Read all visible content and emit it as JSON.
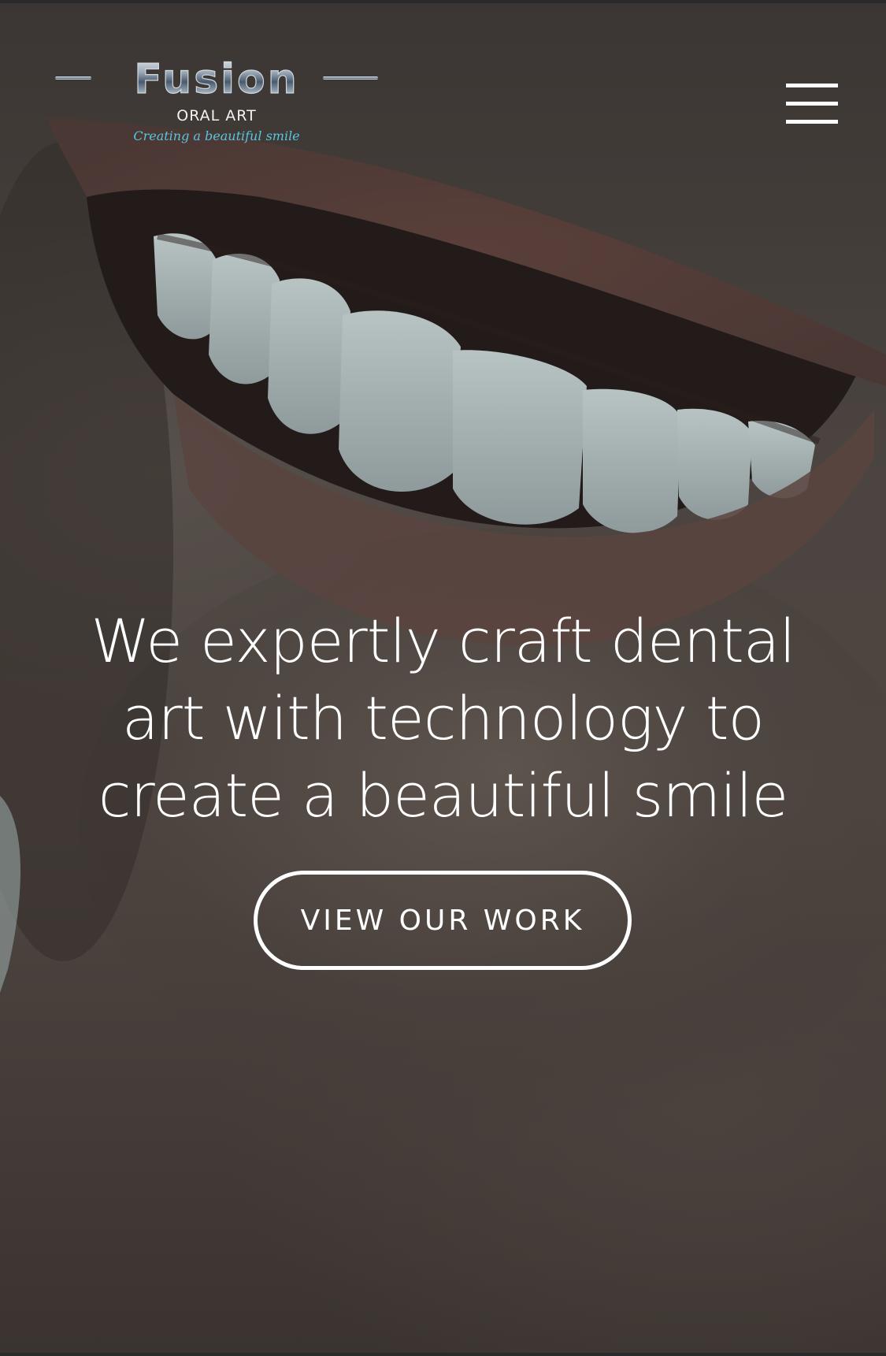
{
  "brand": {
    "wordmark": "Fusion",
    "subtitle": "ORAL ART",
    "tagline": "Creating a beautiful smile"
  },
  "nav": {
    "menu_icon": "hamburger-menu-icon"
  },
  "hero": {
    "headline": "We expertly craft dental art with technology to create a beautiful smile",
    "cta_label": "VIEW OUR WORK"
  },
  "colors": {
    "text": "#ffffff",
    "tagline": "#57c6de",
    "background": "#4b4440"
  }
}
